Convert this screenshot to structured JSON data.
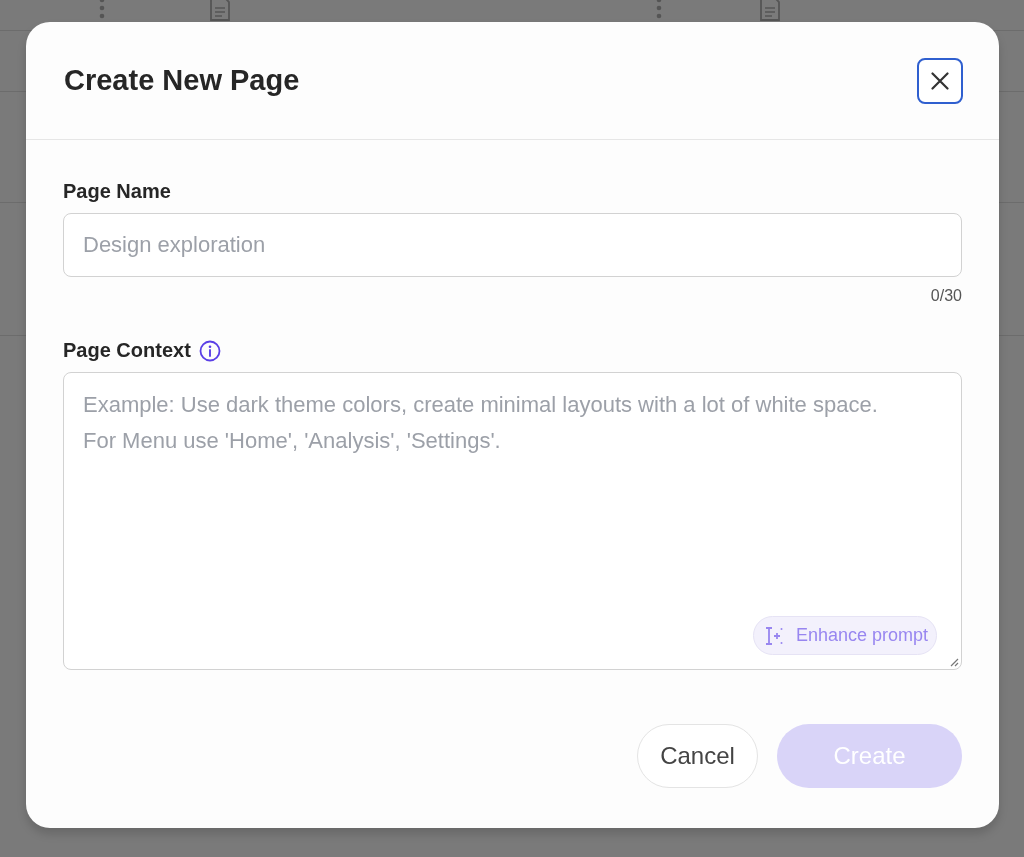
{
  "dialog": {
    "title": "Create New Page",
    "page_name": {
      "label": "Page Name",
      "placeholder": "Design exploration",
      "counter": "0/30"
    },
    "page_context": {
      "label": "Page Context",
      "placeholder": "Example: Use dark theme colors, create minimal layouts with a lot of white space. For Menu use 'Home', 'Analysis', 'Settings'.",
      "enhance_button": "Enhance prompt"
    },
    "buttons": [
      {
        "label": "Cancel",
        "kind": "secondary",
        "disabled": false
      },
      {
        "label": "Create",
        "kind": "primary",
        "disabled": true
      }
    ]
  }
}
